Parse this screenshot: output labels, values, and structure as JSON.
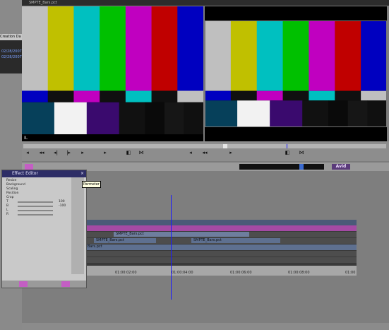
{
  "topbar": {
    "title": "SMPTE_Bars.pct"
  },
  "bin": {
    "tab_label": "Creation Da",
    "dates": [
      "02/28/2007",
      "02/28/2007"
    ]
  },
  "effect_editor": {
    "title": "Effect Editor",
    "params": [
      "Resize",
      "Background",
      "Scaling",
      "Position",
      "Crop",
      "T",
      "B",
      "L",
      "R"
    ],
    "values": [
      "100",
      "-100"
    ]
  },
  "tooltip": {
    "text": "Parmeter"
  },
  "clips": {
    "v1": "SMPTE_Bars.pct",
    "v_low": "SMPTE_Bars.pct",
    "v_low2": "SMPTE_Bars.pct",
    "a1": "Bars.pct"
  },
  "ruler": {
    "ticks": [
      "01:00:02:00",
      "01:00:04:00",
      "01:00:06:00",
      "01:00:08:00",
      "01:00"
    ]
  },
  "brand": {
    "logo": "Avid"
  },
  "bars_colors": [
    "#bfbfbf",
    "#c0c000",
    "#00c0c0",
    "#00c000",
    "#c000c0",
    "#c00000",
    "#0000c0"
  ],
  "timecode": {
    "label": "IL"
  }
}
